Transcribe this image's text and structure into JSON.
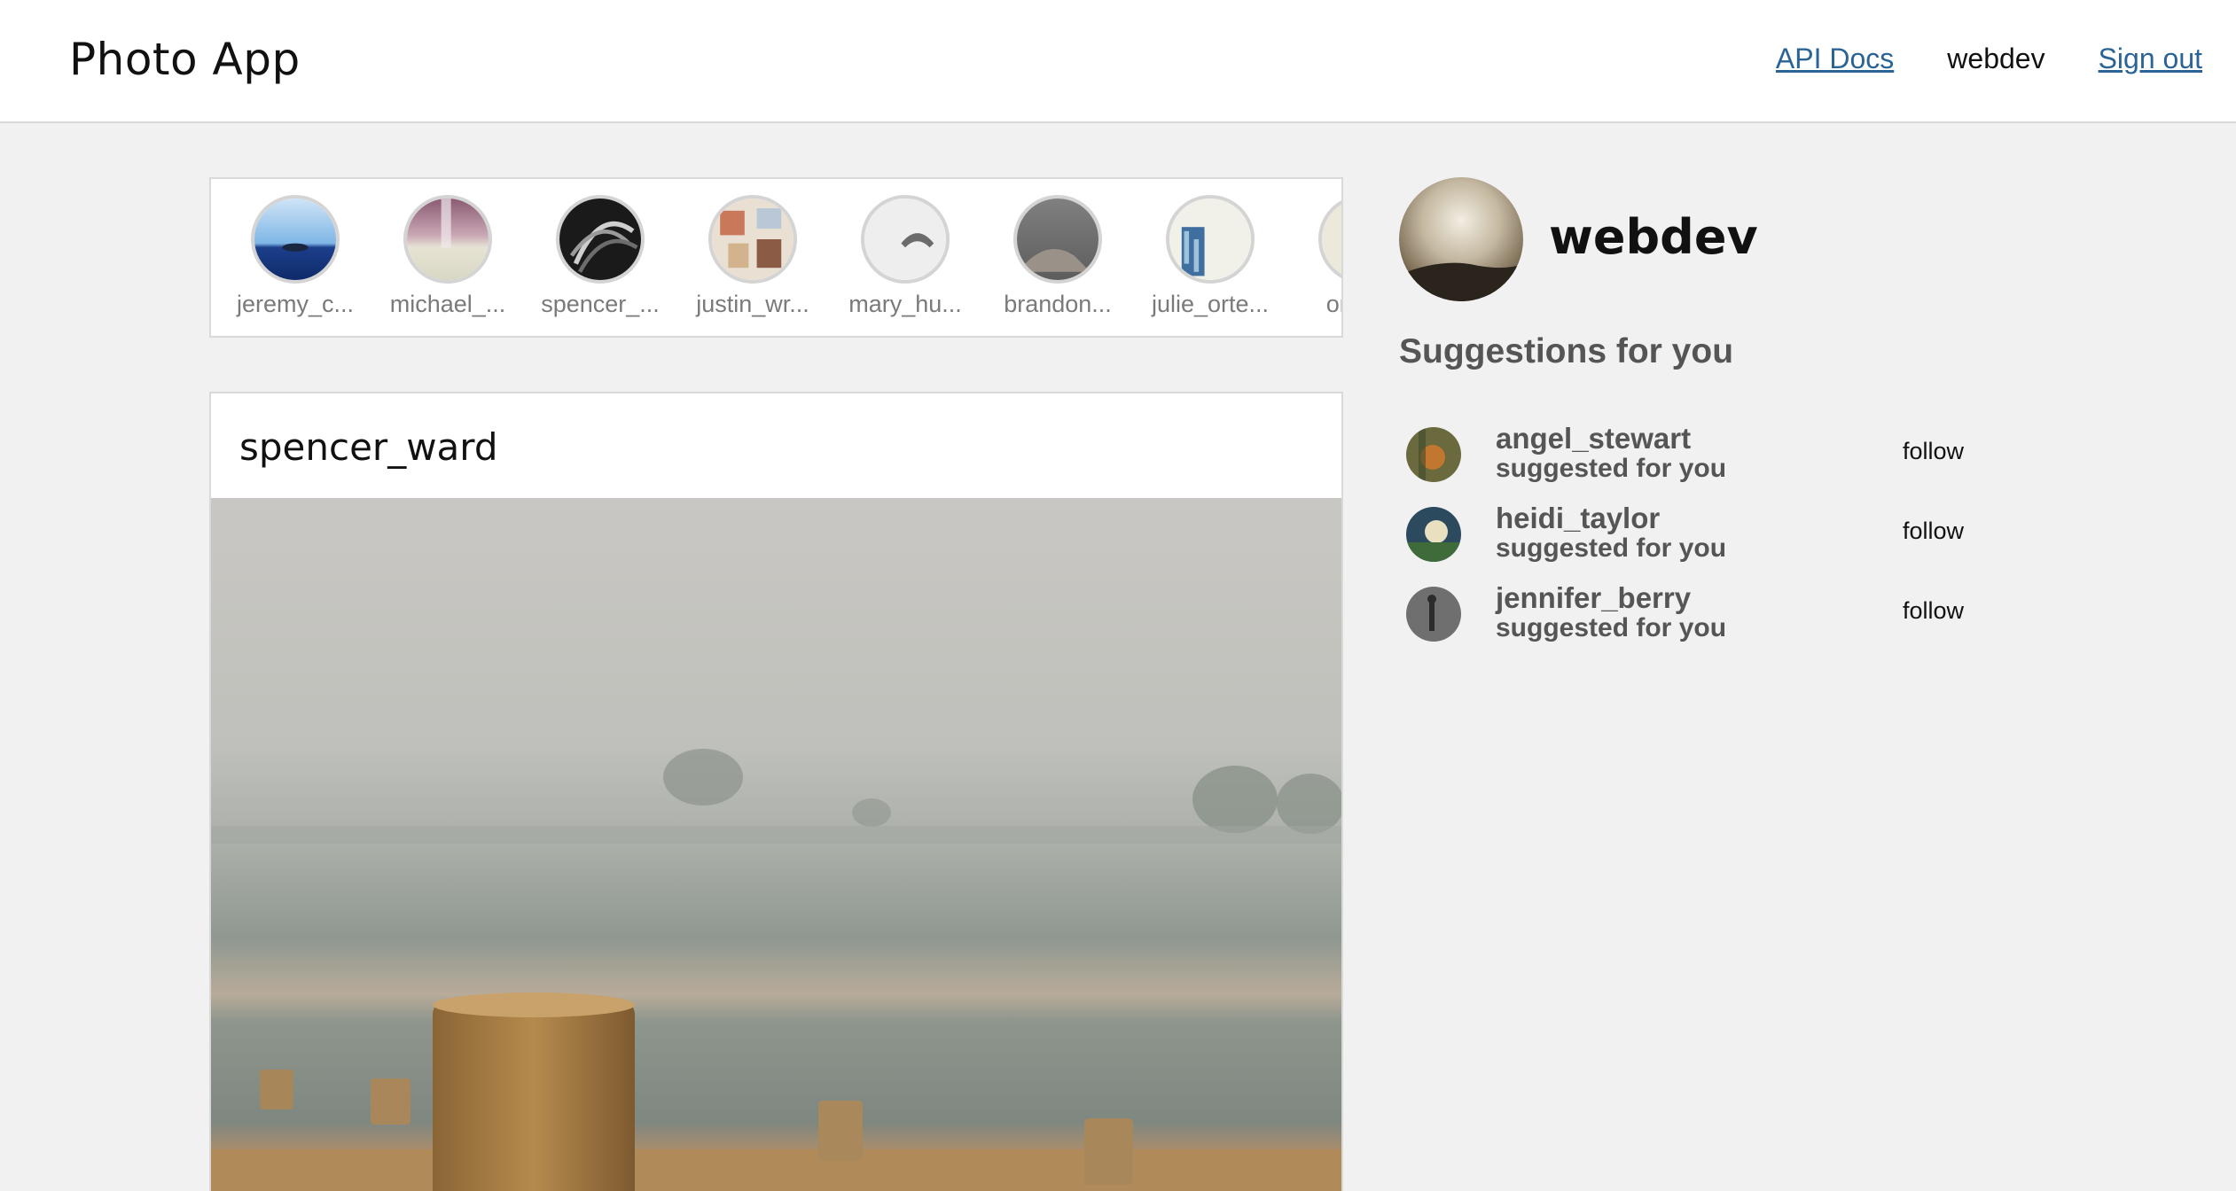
{
  "header": {
    "brand": "Photo App",
    "api_docs": "API Docs",
    "username": "webdev",
    "sign_out": "Sign out"
  },
  "stories": [
    {
      "name": "jeremy_c..."
    },
    {
      "name": "michael_..."
    },
    {
      "name": "spencer_..."
    },
    {
      "name": "justin_wr..."
    },
    {
      "name": "mary_hu..."
    },
    {
      "name": "brandon..."
    },
    {
      "name": "julie_orte..."
    },
    {
      "name": "omar..."
    }
  ],
  "post": {
    "username": "spencer_ward"
  },
  "profile": {
    "username": "webdev"
  },
  "suggestions": {
    "title": "Suggestions for you",
    "items": [
      {
        "name": "angel_stewart",
        "subtitle": "suggested for you",
        "action": "follow"
      },
      {
        "name": "heidi_taylor",
        "subtitle": "suggested for you",
        "action": "follow"
      },
      {
        "name": "jennifer_berry",
        "subtitle": "suggested for you",
        "action": "follow"
      }
    ]
  }
}
